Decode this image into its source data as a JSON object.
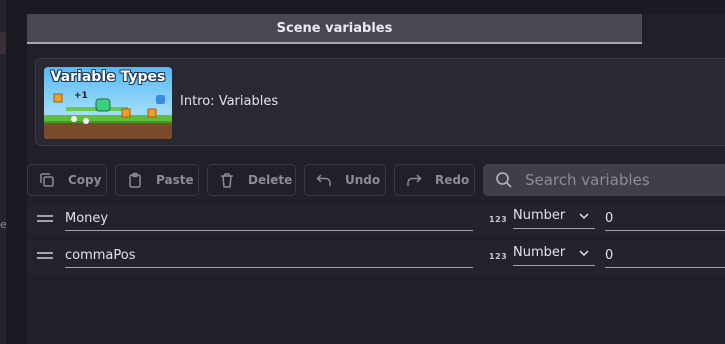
{
  "panel": {
    "title": "Scene variables"
  },
  "tutorial": {
    "thumbnail_title": "Variable Types",
    "thumbnail_badge": "+1",
    "title": "Intro: Variables"
  },
  "toolbar": {
    "copy_label": "Copy",
    "paste_label": "Paste",
    "delete_label": "Delete",
    "undo_label": "Undo",
    "redo_label": "Redo"
  },
  "search": {
    "placeholder": "Search variables",
    "value": ""
  },
  "variables": [
    {
      "name": "Money",
      "type_icon": "123",
      "type": "Number",
      "value": "0"
    },
    {
      "name": "commaPos",
      "type_icon": "123",
      "type": "Number",
      "value": "0"
    }
  ],
  "sidebar": {
    "letter": "e"
  },
  "colors": {
    "panel_bg": "#211f28",
    "header_bg": "#4a4752",
    "search_bg": "#403e48"
  }
}
